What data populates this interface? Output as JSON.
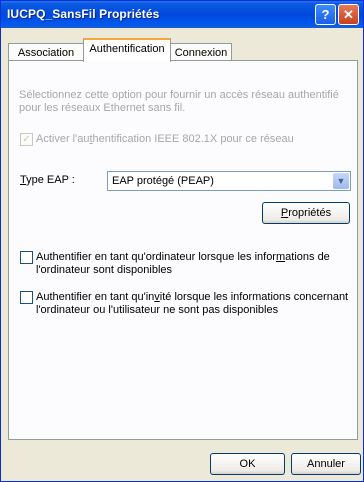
{
  "window": {
    "title": "IUCPQ_SansFil Propriétés",
    "help_label": "?",
    "close_label": "✕"
  },
  "tabs": [
    {
      "label": "Association"
    },
    {
      "label": "Authentification"
    },
    {
      "label": "Connexion"
    }
  ],
  "auth": {
    "description": "Sélectionnez cette option pour fournir un accès réseau authentifié pour les réseaux Ethernet sans fil.",
    "enable_8021x": {
      "pre": "Activer l'au",
      "key": "t",
      "post": "hentification IEEE 802.1X pour ce réseau",
      "checked": true,
      "disabled": true
    },
    "eap_type": {
      "label_key": "T",
      "label_rest": "ype EAP :",
      "value": "EAP protégé (PEAP)"
    },
    "properties_button": {
      "key": "P",
      "rest": "ropriétés"
    },
    "computer_auth": {
      "line1_pre": "Authentifier en tant qu'ordinateur lorsque les infor",
      "line1_key": "m",
      "line1_post": "ations de",
      "line2": "l'ordinateur sont disponibles",
      "checked": false
    },
    "guest_auth": {
      "line1_pre": "Authentifier en tant qu'in",
      "line1_key": "v",
      "line1_post": "ité lorsque les informations concernant",
      "line2": "l'ordinateur ou l'utilisateur ne sont pas disponibles",
      "checked": false
    }
  },
  "footer": {
    "ok_label": "OK",
    "cancel_label": "Annuler"
  }
}
